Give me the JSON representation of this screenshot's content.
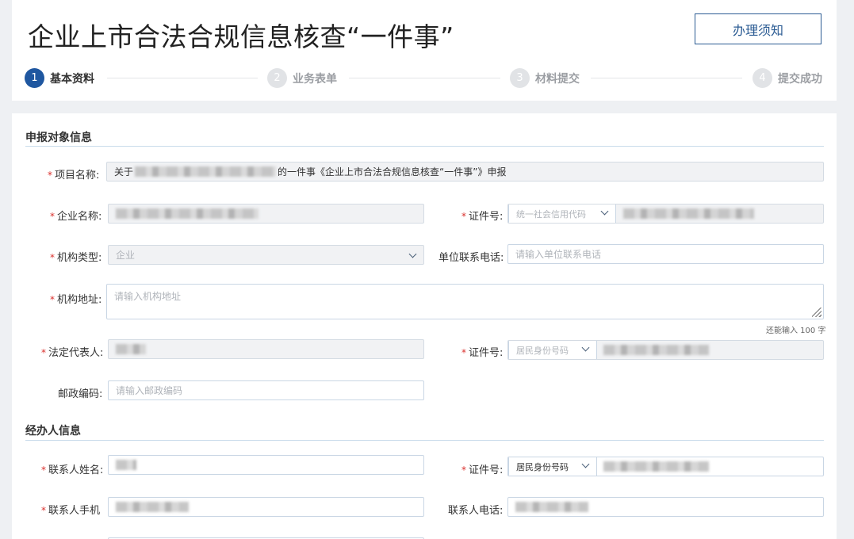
{
  "header": {
    "title": "企业上市合法合规信息核查“一件事”",
    "notice_button": "办理须知"
  },
  "steps": [
    {
      "num": "1",
      "label": "基本资料",
      "active": true
    },
    {
      "num": "2",
      "label": "业务表单",
      "active": false
    },
    {
      "num": "3",
      "label": "材料提交",
      "active": false
    },
    {
      "num": "4",
      "label": "提交成功",
      "active": false
    }
  ],
  "section_applicant": {
    "title": "申报对象信息",
    "project_name_label": "项目名称:",
    "project_name_prefix": "关于",
    "project_name_suffix": "的一件事《企业上市合法合规信息核查“一件事”》申报",
    "company_name_label": "企业名称:",
    "company_id_label": "证件号:",
    "company_id_type_placeholder": "统一社会信用代码",
    "org_type_label": "机构类型:",
    "org_type_value": "企业",
    "unit_phone_label": "单位联系电话:",
    "unit_phone_placeholder": "请输入单位联系电话",
    "org_address_label": "机构地址:",
    "org_address_placeholder": "请输入机构地址",
    "org_address_counter": "还能输入 100 字",
    "legal_rep_label": "法定代表人:",
    "legal_rep_id_label": "证件号:",
    "legal_rep_id_type_placeholder": "居民身份号码",
    "postal_code_label": "邮政编码:",
    "postal_code_placeholder": "请输入邮政编码"
  },
  "section_agent": {
    "title": "经办人信息",
    "contact_name_label": "联系人姓名:",
    "contact_id_label": "证件号:",
    "contact_id_type": "居民身份号码",
    "contact_mobile_label": "联系人手机",
    "contact_phone_label": "联系人电话:"
  },
  "colors": {
    "accent": "#1f57a0",
    "required": "#d9302c",
    "border": "#c9d6e4"
  }
}
